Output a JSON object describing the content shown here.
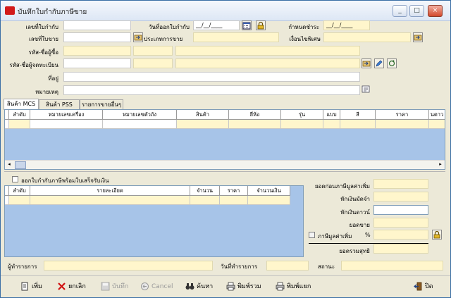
{
  "window": {
    "title": "บันทึกใบกำกับภาษีขาย"
  },
  "form": {
    "doc_no_label": "เลขที่ใบกำกับ",
    "doc_no_value": "",
    "issue_date_label": "วันที่ออกใบกำกับ",
    "issue_date_value": "__/__/____",
    "due_date_label": "กำหนดชำระ",
    "due_date_value": "__/__/____",
    "sale_no_label": "เลขที่ใบขาย",
    "sale_type_label": "ประเภทการขาย",
    "special_cond_label": "เงื่อนไขพิเศษ",
    "buyer_label": "รหัส-ชื่อผู้ซื้อ",
    "registrant_label": "รหัส-ชื่อผู้จดทะเบียน",
    "address_label": "ที่อยู่",
    "note_label": "หมายเหตุ"
  },
  "tabs": [
    {
      "label": "สินค้า MCS"
    },
    {
      "label": "สินค้า PSS"
    },
    {
      "label": "รายการขายอื่นๆ"
    }
  ],
  "grid1": {
    "columns": [
      "ลำดับ",
      "หมายเลขเครื่อง",
      "หมายเลขตัวถัง",
      "สินค้า",
      "ยี่ห้อ",
      "รุ่น",
      "แบบ",
      "สี",
      "ราคา",
      "นตาว"
    ]
  },
  "receipt": {
    "checkbox_label": "ออกใบกำกับภาษีพร้อมใบเสร็จรับเงิน",
    "columns": [
      "ลำดับ",
      "รายละเอียด",
      "จำนวน",
      "ราคา",
      "จำนวนเงิน"
    ]
  },
  "totals": {
    "before_vat_label": "ยอดก่อนภาษีมูลค่าเพิ่ม",
    "deposit_label": "หักเงินมัดจำ",
    "down_label": "หักเงินดาวน์",
    "sale_total_label": "ยอดขาย",
    "vat_label": "ภาษีมูลค่าเพิ่ม",
    "vat_pct": "%",
    "grand_total_label": "ยอดรวมสุทธิ"
  },
  "footer": {
    "recorder_label": "ผู้ทำรายการ",
    "record_date_label": "วันที่ทำรายการ",
    "status_label": "สถานะ"
  },
  "toolbar": {
    "add": "เพิ่ม",
    "cancel_doc": "ยกเลิก",
    "save": "บันทึก",
    "cancel": "Cancel",
    "search": "ค้นหา",
    "print_all": "พิมพ์รวม",
    "print_split": "พิมพ์แยก",
    "close": "ปิด"
  },
  "colors": {
    "accent": "#a7c4e8",
    "field_yellow": "#fff6cc",
    "title_bg": "#dde7f5"
  }
}
